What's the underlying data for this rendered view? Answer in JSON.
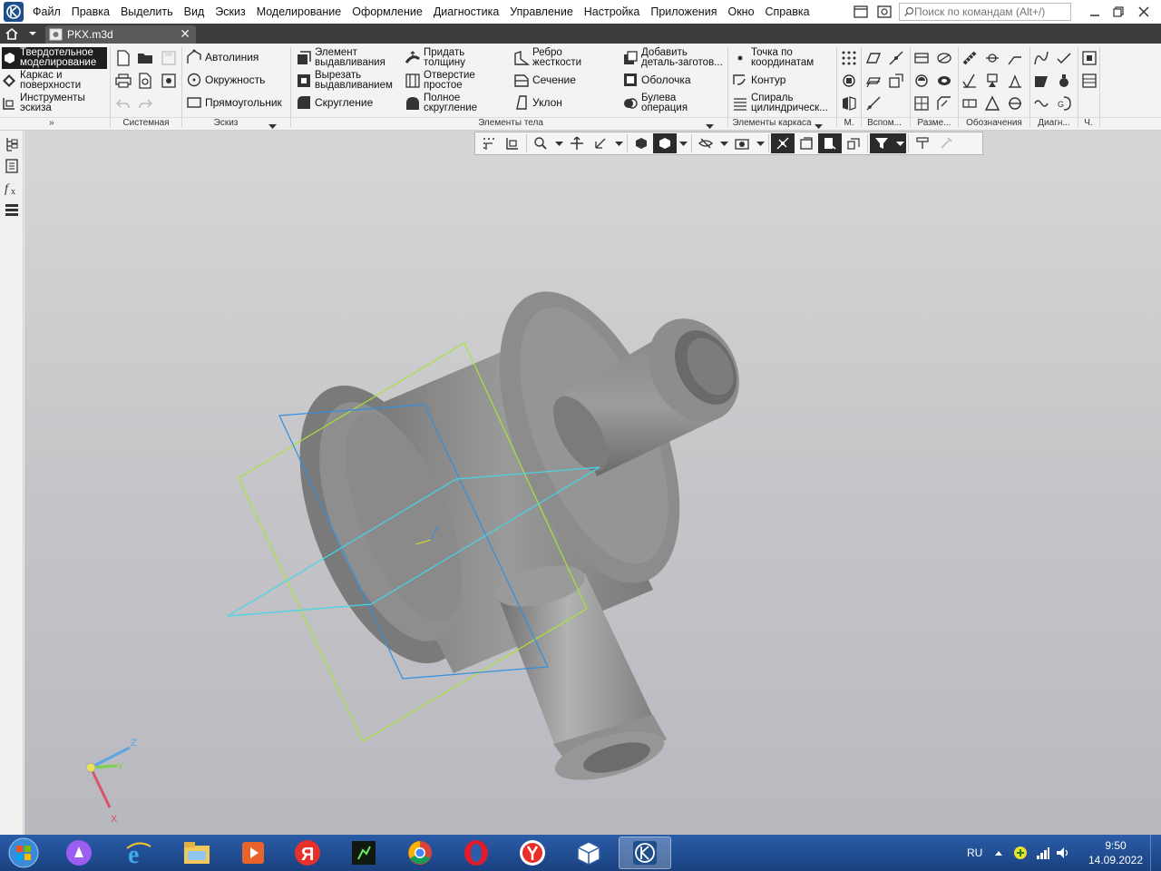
{
  "menubar": {
    "items": [
      "Файл",
      "Правка",
      "Выделить",
      "Вид",
      "Эскиз",
      "Моделирование",
      "Оформление",
      "Диагностика",
      "Управление",
      "Настройка",
      "Приложения",
      "Окно",
      "Справка"
    ],
    "search_placeholder": "Поиск по командам (Alt+/)"
  },
  "tab": {
    "title": "PKX.m3d",
    "close": "✕"
  },
  "ribbon": {
    "modes": [
      "Твердотельное моделирование",
      "Каркас и поверхности",
      "Инструменты эскиза"
    ],
    "sketch": {
      "autoline": "Автолиния",
      "circle": "Окружность",
      "rectangle": "Прямоугольник"
    },
    "body": {
      "extrude": "Элемент выдавливания",
      "cut_extrude": "Вырезать выдавливанием",
      "fillet": "Скругление",
      "thicken": "Придать толщину",
      "hole": "Отверстие простое",
      "full_round": "Полное скругление",
      "rib": "Ребро жесткости",
      "section": "Сечение",
      "draft": "Уклон",
      "add_blank": "Добавить деталь-заготов...",
      "shell": "Оболочка",
      "boolean": "Булева операция"
    },
    "frame": {
      "point_coords": "Точка по координатам",
      "contour": "Контур",
      "spiral": "Спираль цилиндрическ..."
    },
    "groups": {
      "system": "Системная",
      "sketch": "Эскиз",
      "body": "Элементы тела",
      "frame": "Элементы каркаса",
      "m": "М.",
      "aux": "Вспом...",
      "dims": "Разме...",
      "notation": "Обозначения",
      "diag": "Диагн...",
      "ch": "Ч."
    }
  },
  "axes": {
    "x": "X",
    "y": "Y",
    "z": "Z"
  },
  "taskbar": {
    "lang": "RU",
    "time": "9:50",
    "date": "14.09.2022"
  },
  "colors": {
    "app_accent": "#1e4f8a",
    "model_gray": "#8a8a8a",
    "plane_green": "#a6e33a",
    "plane_blue": "#2f8fe0",
    "plane_cyan": "#43d6e8"
  }
}
